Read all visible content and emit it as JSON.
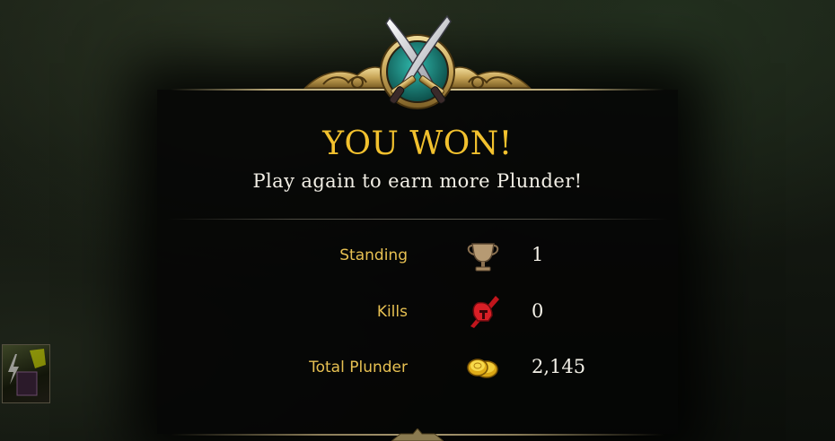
{
  "result": {
    "title": "YOU WON!",
    "subtitle": "Play again to earn more Plunder!"
  },
  "stats": [
    {
      "label": "Standing",
      "value": "1",
      "icon": "trophy-icon"
    },
    {
      "label": "Kills",
      "value": "0",
      "icon": "crimson-helmet-sword-icon"
    },
    {
      "label": "Total Plunder",
      "value": "2,145",
      "icon": "gold-coins-icon"
    }
  ],
  "colors": {
    "title_gold": "#f2c12e",
    "label_gold": "#e7c052",
    "value_white": "#f4f1e8",
    "emblem_teal": "#1c8f86"
  }
}
